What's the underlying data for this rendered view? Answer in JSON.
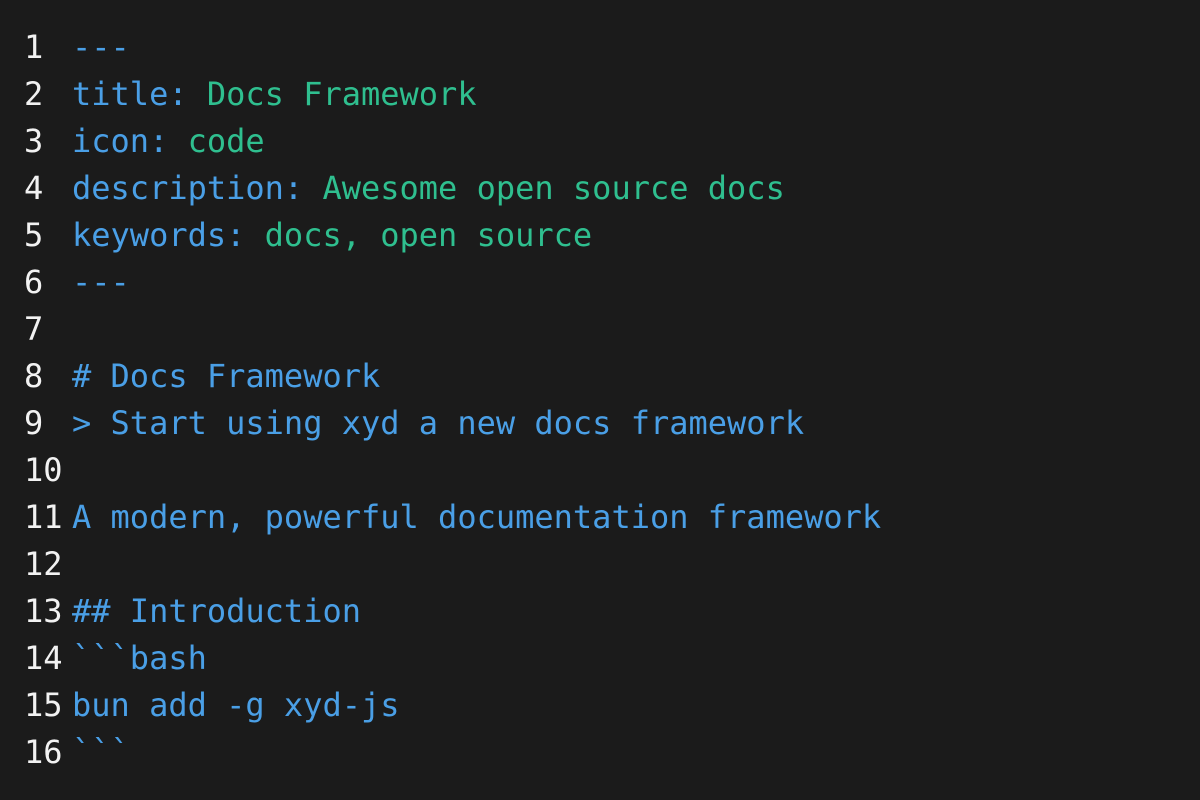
{
  "colors": {
    "background": "#1b1b1b",
    "line_number": "#f2f2f2",
    "markdown": "#4a9fe6",
    "yaml_value": "#2fbf8f"
  },
  "lines": [
    {
      "n": "1",
      "k": "---",
      "v": ""
    },
    {
      "n": "2",
      "k": "title: ",
      "v": "Docs Framework"
    },
    {
      "n": "3",
      "k": "icon: ",
      "v": "code"
    },
    {
      "n": "4",
      "k": "description: ",
      "v": "Awesome open source docs"
    },
    {
      "n": "5",
      "k": "keywords: ",
      "v": "docs, open source"
    },
    {
      "n": "6",
      "k": "---",
      "v": ""
    },
    {
      "n": "7",
      "k": "",
      "v": ""
    },
    {
      "n": "8",
      "k": "# Docs Framework",
      "v": ""
    },
    {
      "n": "9",
      "k": "> Start using xyd a new docs framework",
      "v": ""
    },
    {
      "n": "10",
      "k": "",
      "v": ""
    },
    {
      "n": "11",
      "k": "A modern, powerful documentation framework",
      "v": ""
    },
    {
      "n": "12",
      "k": "",
      "v": ""
    },
    {
      "n": "13",
      "k": "## Introduction",
      "v": ""
    },
    {
      "n": "14",
      "k": "```bash",
      "v": ""
    },
    {
      "n": "15",
      "k": "bun add -g xyd-js",
      "v": ""
    },
    {
      "n": "16",
      "k": "```",
      "v": ""
    }
  ]
}
